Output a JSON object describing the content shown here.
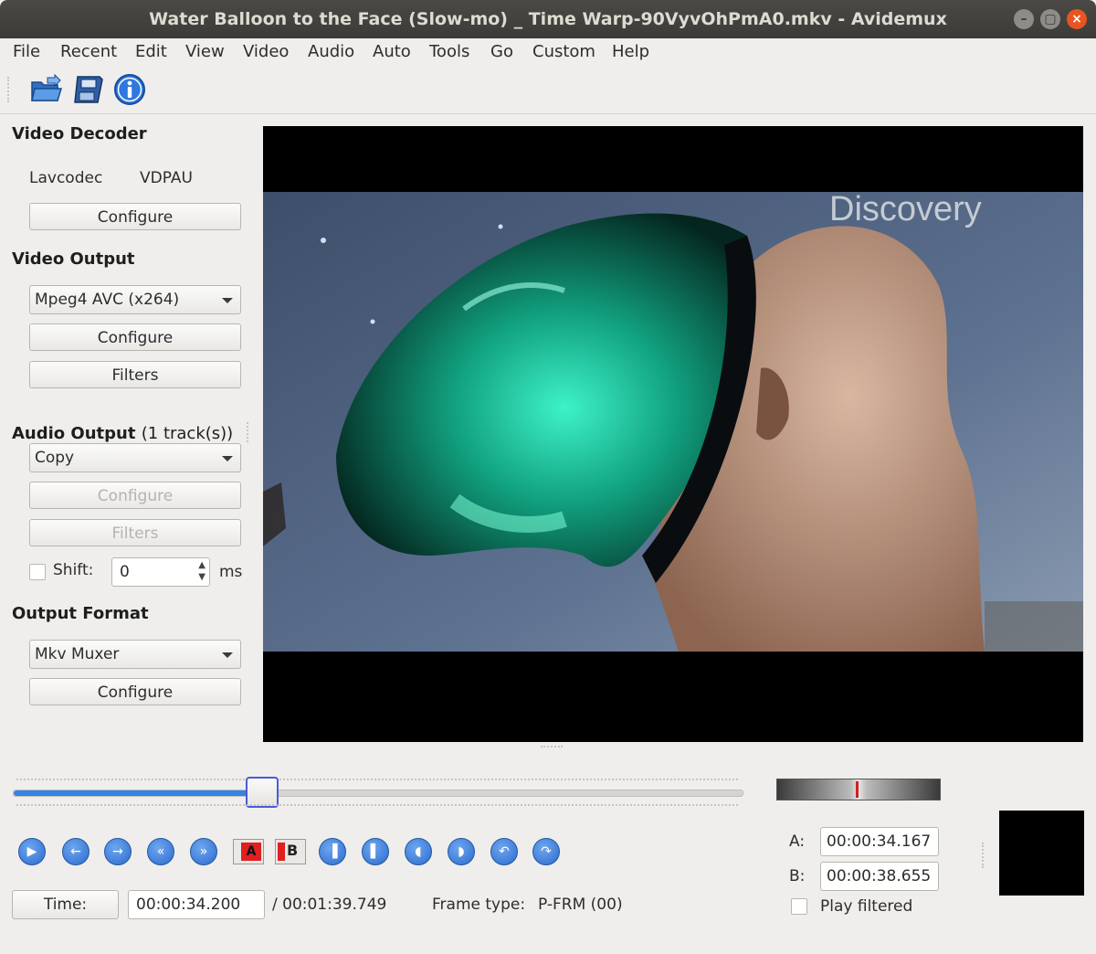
{
  "window": {
    "title": "Water Balloon to the Face (Slow-mo) _ Time Warp-90VyvOhPmA0.mkv - Avidemux",
    "controls": [
      "minimize-icon",
      "maximize-icon",
      "close-icon"
    ]
  },
  "menu": [
    "File",
    "Recent",
    "Edit",
    "View",
    "Video",
    "Audio",
    "Auto",
    "Tools",
    "Go",
    "Custom",
    "Help"
  ],
  "toolbar": {
    "icons": [
      "open-file-icon",
      "save-file-icon",
      "info-icon"
    ]
  },
  "video_decoder": {
    "title": "Video Decoder",
    "decoder": "Lavcodec",
    "hw": "VDPAU",
    "configure": "Configure"
  },
  "video_output": {
    "title": "Video Output",
    "codec": "Mpeg4 AVC (x264)",
    "configure": "Configure",
    "filters": "Filters"
  },
  "audio_output": {
    "title": "Audio Output",
    "tracks": "(1 track(s))",
    "codec": "Copy",
    "configure": "Configure",
    "filters": "Filters",
    "shift_label": "Shift:",
    "shift_value": "0",
    "shift_unit": "ms"
  },
  "output_format": {
    "title": "Output Format",
    "muxer": "Mkv Muxer",
    "configure": "Configure"
  },
  "preview": {
    "watermark": "Discovery"
  },
  "timeline": {
    "position_fraction": 0.342
  },
  "controls": {
    "buttons": [
      "play",
      "previous-frame",
      "next-frame",
      "previous-intra-frame",
      "next-intra-frame",
      "set-marker-a",
      "set-marker-b",
      "previous-cut-point",
      "next-cut-point",
      "goto-marker-a",
      "goto-marker-b",
      "previous-black-frame",
      "next-black-frame"
    ]
  },
  "status": {
    "time_button": "Time:",
    "current_time": "00:00:34.200",
    "total_time": "/ 00:01:39.749",
    "frame_type_label": "Frame type:",
    "frame_type": "P-FRM (00)"
  },
  "markers": {
    "a_label": "A:",
    "a_value": "00:00:34.167",
    "b_label": "B:",
    "b_value": "00:00:38.655",
    "play_filtered": "Play filtered"
  }
}
